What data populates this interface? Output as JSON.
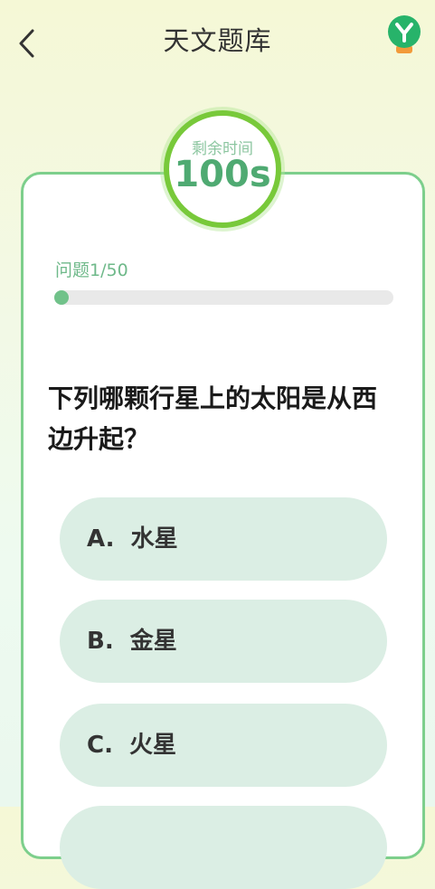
{
  "header": {
    "title": "天文题库",
    "back_icon": "chevron-left-icon",
    "avatar_icon": "green-y-logo-icon"
  },
  "timer": {
    "label": "剩余时间",
    "value": "100s"
  },
  "progress": {
    "label": "问题1/50",
    "current": 1,
    "total": 50
  },
  "question": {
    "text": "下列哪颗行星上的太阳是从西边升起？"
  },
  "options": [
    {
      "letter": "A.",
      "text": "水星",
      "display": "A.  水星"
    },
    {
      "letter": "B.",
      "text": "金星",
      "display": "B.  金星"
    },
    {
      "letter": "C.",
      "text": "火星",
      "display": "C.  火星"
    }
  ],
  "colors": {
    "accent_green": "#71c28a",
    "timer_ring": "#78c93a",
    "timer_text": "#4faa72",
    "card_border": "#7dcf8c",
    "option_bg": "#dbeee4"
  }
}
